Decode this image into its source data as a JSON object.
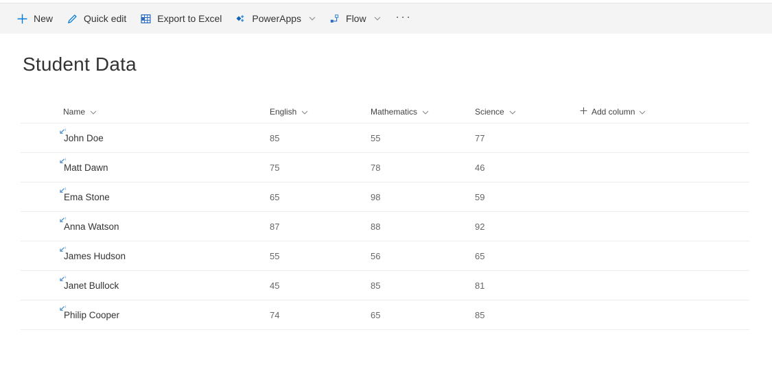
{
  "command_bar": {
    "items": [
      {
        "label": "New",
        "icon": "plus-icon",
        "dropdown": false
      },
      {
        "label": "Quick edit",
        "icon": "pencil-icon",
        "dropdown": false
      },
      {
        "label": "Export to Excel",
        "icon": "excel-icon",
        "dropdown": false
      },
      {
        "label": "PowerApps",
        "icon": "powerapps-icon",
        "dropdown": true
      },
      {
        "label": "Flow",
        "icon": "flow-icon",
        "dropdown": true
      }
    ],
    "more_label": "···"
  },
  "page": {
    "title": "Student Data"
  },
  "list": {
    "columns": [
      "Name",
      "English",
      "Mathematics",
      "Science"
    ],
    "add_column_label": "Add column",
    "rows": [
      {
        "name": "John Doe",
        "english": "85",
        "mathematics": "55",
        "science": "77"
      },
      {
        "name": "Matt Dawn",
        "english": "75",
        "mathematics": "78",
        "science": "46"
      },
      {
        "name": "Ema Stone",
        "english": "65",
        "mathematics": "98",
        "science": "59"
      },
      {
        "name": "Anna Watson",
        "english": "87",
        "mathematics": "88",
        "science": "92"
      },
      {
        "name": "James Hudson",
        "english": "55",
        "mathematics": "56",
        "science": "65"
      },
      {
        "name": "Janet Bullock",
        "english": "45",
        "mathematics": "85",
        "science": "81"
      },
      {
        "name": "Philip Cooper",
        "english": "74",
        "mathematics": "65",
        "science": "85"
      }
    ]
  },
  "colors": {
    "accent": "#0078d4",
    "command_bar_bg": "#f4f4f4"
  }
}
